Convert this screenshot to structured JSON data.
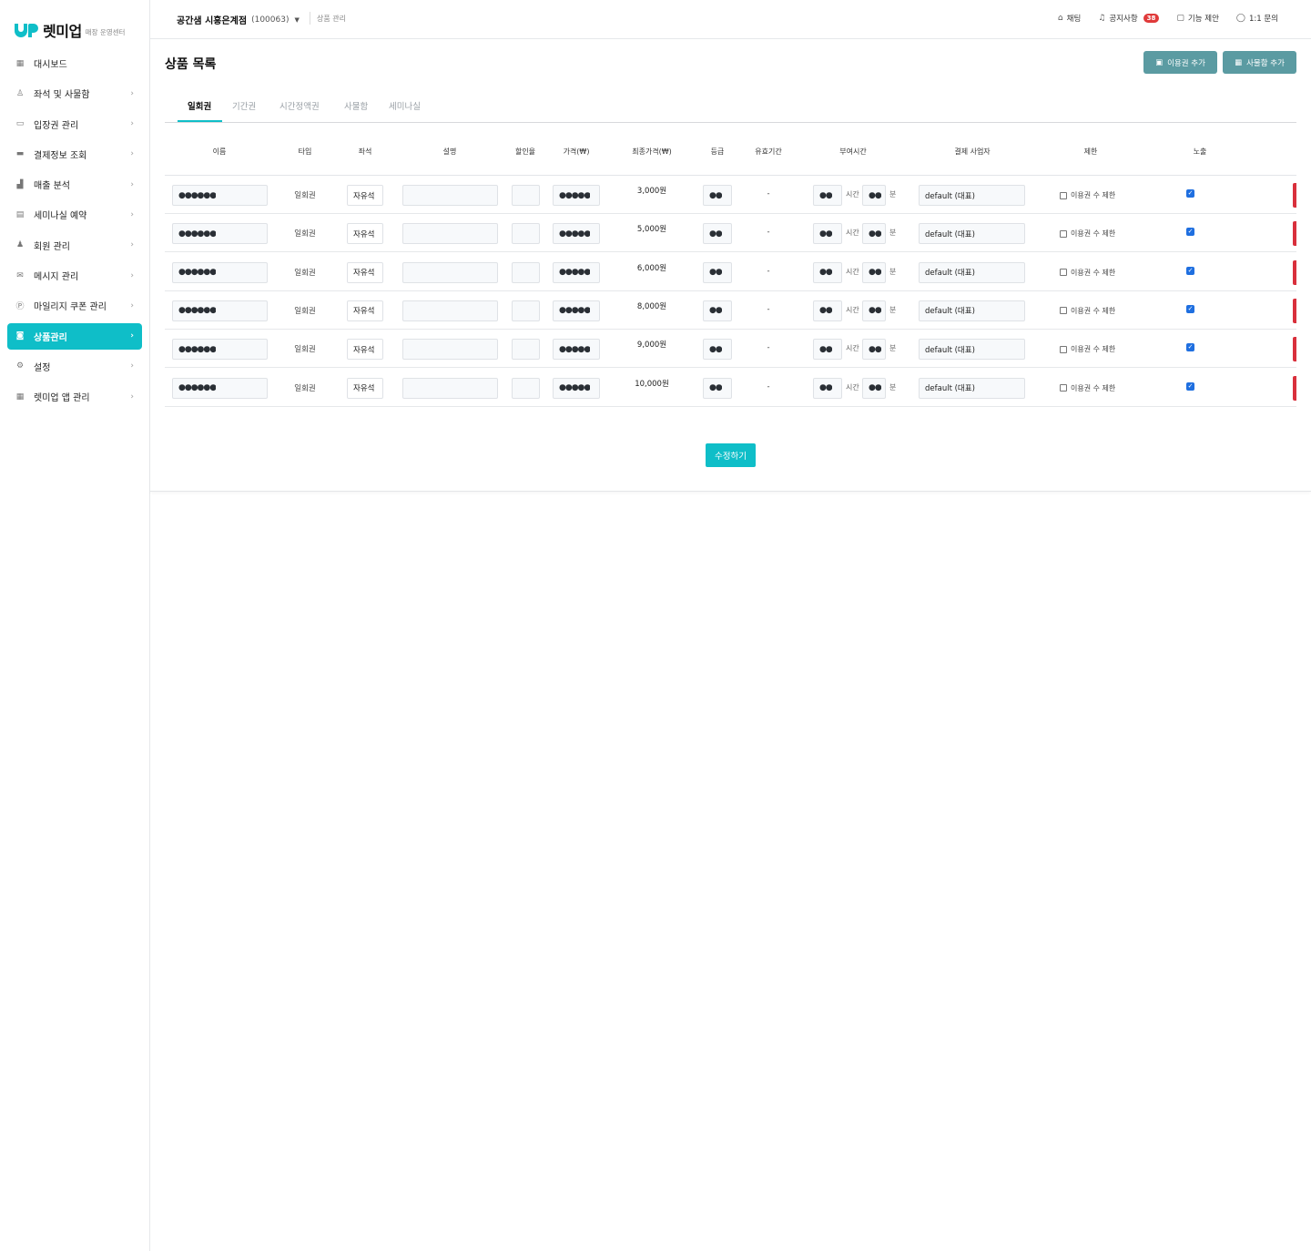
{
  "brand": {
    "name": "렛미업",
    "subtitle": "매장 운영센터"
  },
  "sidebar": {
    "items": [
      {
        "label": "대시보드",
        "icon": "grid-icon",
        "glyph": "▦",
        "chevron": "",
        "active": false
      },
      {
        "label": "좌석 및 사물함",
        "icon": "seat-icon",
        "glyph": "♙",
        "chevron": "›",
        "active": false
      },
      {
        "label": "입장권 관리",
        "icon": "ticket-icon",
        "glyph": "▭",
        "chevron": "›",
        "active": false
      },
      {
        "label": "결제정보 조회",
        "icon": "card-icon",
        "glyph": "▬",
        "chevron": "›",
        "active": false
      },
      {
        "label": "매출 분석",
        "icon": "chart-icon",
        "glyph": "▟",
        "chevron": "›",
        "active": false
      },
      {
        "label": "세미나실 예약",
        "icon": "calendar-icon",
        "glyph": "▤",
        "chevron": "›",
        "active": false
      },
      {
        "label": "회원 관리",
        "icon": "users-icon",
        "glyph": "♟",
        "chevron": "›",
        "active": false
      },
      {
        "label": "메시지 관리",
        "icon": "mail-icon",
        "glyph": "✉",
        "chevron": "›",
        "active": false
      },
      {
        "label": "마일리지 쿠폰 관리",
        "icon": "coin-icon",
        "glyph": "Ⓟ",
        "chevron": "›",
        "active": false
      },
      {
        "label": "상품관리",
        "icon": "bag-icon",
        "glyph": "◙",
        "chevron": "›",
        "active": true
      },
      {
        "label": "설정",
        "icon": "gear-icon",
        "glyph": "⚙",
        "chevron": "›",
        "active": false
      },
      {
        "label": "렛미업 앱 관리",
        "icon": "apps-icon",
        "glyph": "▦",
        "chevron": "›",
        "active": false
      }
    ]
  },
  "header": {
    "store_name": "공간샘 시흥은계점",
    "store_id": "(100063)",
    "breadcrumb": "상품 관리",
    "actions": {
      "chat": "채팅",
      "notice": "공지사항",
      "notice_count": "38",
      "feature": "기능 제안",
      "inquiry": "1:1 문의"
    }
  },
  "page": {
    "title": "상품 목록",
    "add_ticket": "이용권 추가",
    "add_locker": "사물함 추가",
    "submit": "수정하기"
  },
  "tabs": [
    "일회권",
    "기간권",
    "시간정액권",
    "사물함",
    "세미나실"
  ],
  "table": {
    "headers": {
      "name": "이름",
      "type": "타입",
      "seat": "좌석",
      "desc": "설명",
      "discount": "할인율",
      "price": "가격(₩)",
      "final": "최종가격(₩)",
      "grade": "등급",
      "validity": "유효기간",
      "time": "부여시간",
      "merchant": "결제 사업자",
      "limit": "제한",
      "expose": "노출"
    },
    "units": {
      "hour": "시간",
      "minute": "분"
    },
    "limit_label": "이용권 수 제한",
    "rows": [
      {
        "name": "●●●●●●",
        "type": "일회권",
        "seat": "자유석",
        "desc": "",
        "discount": "",
        "price": "●●●●●",
        "final": "3,000원",
        "grade": "●●",
        "validity": "-",
        "hours": "●●",
        "minutes": "●●",
        "merchant": "default (대표)"
      },
      {
        "name": "●●●●●●",
        "type": "일회권",
        "seat": "자유석",
        "desc": "",
        "discount": "",
        "price": "●●●●●",
        "final": "5,000원",
        "grade": "●●",
        "validity": "-",
        "hours": "●●",
        "minutes": "●●",
        "merchant": "default (대표)"
      },
      {
        "name": "●●●●●●",
        "type": "일회권",
        "seat": "자유석",
        "desc": "",
        "discount": "",
        "price": "●●●●●",
        "final": "6,000원",
        "grade": "●●",
        "validity": "-",
        "hours": "●●",
        "minutes": "●●",
        "merchant": "default (대표)"
      },
      {
        "name": "●●●●●●",
        "type": "일회권",
        "seat": "자유석",
        "desc": "",
        "discount": "",
        "price": "●●●●●",
        "final": "8,000원",
        "grade": "●●",
        "validity": "-",
        "hours": "●●",
        "minutes": "●●",
        "merchant": "default (대표)"
      },
      {
        "name": "●●●●●●",
        "type": "일회권",
        "seat": "자유석",
        "desc": "",
        "discount": "",
        "price": "●●●●●",
        "final": "9,000원",
        "grade": "●●",
        "validity": "-",
        "hours": "●●",
        "minutes": "●●",
        "merchant": "default (대표)"
      },
      {
        "name": "●●●●●●",
        "type": "일회권",
        "seat": "자유석",
        "desc": "",
        "discount": "",
        "price": "●●●●●",
        "final": "10,000원",
        "grade": "●●",
        "validity": "-",
        "hours": "●●",
        "minutes": "●●",
        "merchant": "default (대표)"
      }
    ]
  },
  "colors": {
    "accent": "#0fbec8",
    "secondary_button": "#5b9ba2",
    "danger": "#d9303c",
    "badge": "#e03a3a"
  }
}
